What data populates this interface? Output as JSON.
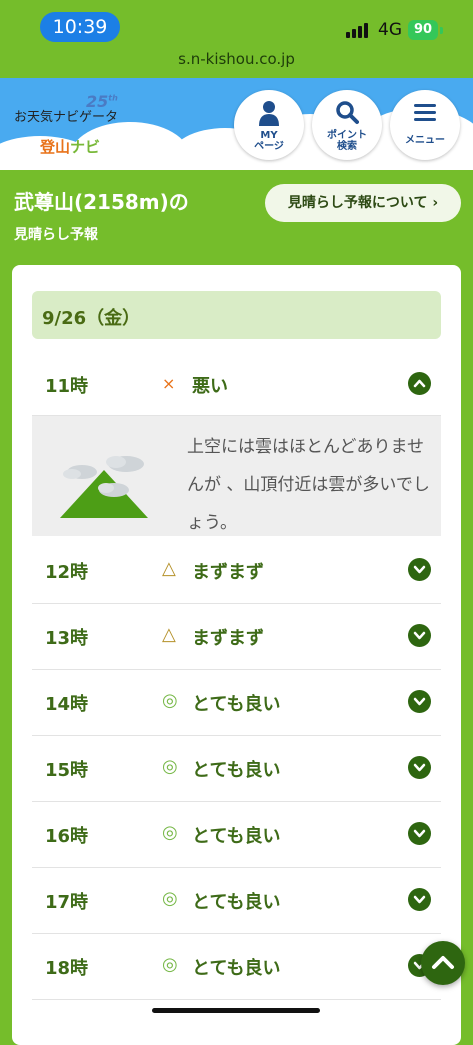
{
  "status": {
    "time": "10:39",
    "network": "4G",
    "battery": "90"
  },
  "browser": {
    "url": "s.n-kishou.co.jp"
  },
  "header": {
    "logo_text": "お天気ナビゲータ",
    "logo_anniversary": "25",
    "logo_anniversary_suffix": "th",
    "logo_sub_a": "登山",
    "logo_sub_b": "ナビ",
    "buttons": [
      {
        "line1": "MY",
        "line2": "ページ",
        "icon": "person-icon"
      },
      {
        "line1": "ポイント",
        "line2": "検索",
        "icon": "search-icon"
      },
      {
        "line1": "メニュー",
        "line2": "",
        "icon": "menu-icon"
      }
    ]
  },
  "page": {
    "title": "武尊山(2158m)の",
    "subtitle": "見晴らし予報",
    "about_button": "見晴らし予報について ›"
  },
  "forecast": {
    "date": "9/26（金）",
    "rows": [
      {
        "hour": "11時",
        "mark": "×",
        "rating": "悪い",
        "expanded": true
      },
      {
        "hour": "12時",
        "mark": "△",
        "rating": "まずまず",
        "expanded": false
      },
      {
        "hour": "13時",
        "mark": "△",
        "rating": "まずまず",
        "expanded": false
      },
      {
        "hour": "14時",
        "mark": "◎",
        "rating": "とても良い",
        "expanded": false
      },
      {
        "hour": "15時",
        "mark": "◎",
        "rating": "とても良い",
        "expanded": false
      },
      {
        "hour": "16時",
        "mark": "◎",
        "rating": "とても良い",
        "expanded": false
      },
      {
        "hour": "17時",
        "mark": "◎",
        "rating": "とても良い",
        "expanded": false
      },
      {
        "hour": "18時",
        "mark": "◎",
        "rating": "とても良い",
        "expanded": false
      }
    ],
    "detail_text": "上空には雲はほとんどありませんが 、山頂付近は雲が多いでしょう。"
  },
  "colors": {
    "page_bg": "#75bd2b",
    "header_sky": "#49aaf0",
    "accent_dark": "#2e6610",
    "text_green": "#3e6b18"
  }
}
